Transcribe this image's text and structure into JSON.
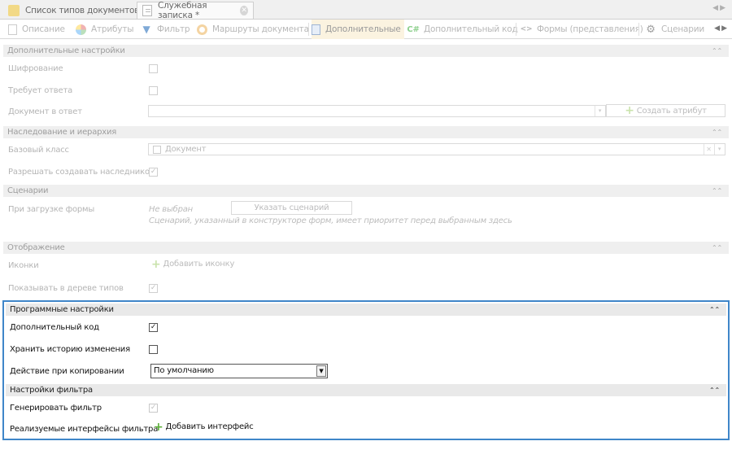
{
  "doc_tabs": [
    {
      "label": "Список типов документов"
    },
    {
      "label": "Служебная записка *"
    }
  ],
  "toolbar": [
    {
      "label": "Описание"
    },
    {
      "label": "Атрибуты"
    },
    {
      "label": "Фильтр"
    },
    {
      "label": "Маршруты документа"
    },
    {
      "label": "Дополнительные"
    },
    {
      "label": "Дополнительный код"
    },
    {
      "label": "Формы (представления)"
    },
    {
      "label": "Сценарии"
    }
  ],
  "sections": {
    "extra": {
      "title": "Дополнительные настройки",
      "encryption": "Шифрование",
      "requires_reply": "Требует ответа",
      "reply_document": "Документ в ответ",
      "create_attribute": "Создать атрибут"
    },
    "inheritance": {
      "title": "Наследование и иерархия",
      "base_class": "Базовый класс",
      "base_class_value": "Документ",
      "allow_inheritors": "Разрешать создавать наследников"
    },
    "scenarios": {
      "title": "Сценарии",
      "on_form_load": "При загрузке формы",
      "not_selected": "Не выбран",
      "set_scenario": "Указать сценарий",
      "hint": "Сценарий, указанный в конструкторе форм, имеет приоритет перед выбранным здесь"
    },
    "display": {
      "title": "Отображение",
      "icons": "Иконки",
      "add_icon": "Добавить иконку",
      "show_in_tree": "Показывать в дереве типов"
    },
    "program": {
      "title": "Программные настройки",
      "additional_code": "Дополнительный код",
      "keep_history": "Хранить историю изменения",
      "copy_action": "Действие при копировании",
      "copy_action_value": "По умолчанию"
    },
    "filter": {
      "title": "Настройки фильтра",
      "generate_filter": "Генерировать фильтр",
      "interfaces": "Реализуемые интерфейсы фильтра",
      "add_interface": "Добавить интерфейс"
    }
  },
  "checks": {
    "encryption": false,
    "requires_reply": false,
    "allow_inheritors": true,
    "show_in_tree": true,
    "additional_code": true,
    "keep_history": false,
    "generate_filter": true
  },
  "colors": {
    "highlight_border": "#3f86c9",
    "add_icon_green": "#5db03a"
  }
}
